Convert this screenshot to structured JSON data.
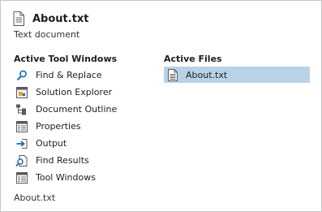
{
  "header": {
    "title": "About.txt",
    "subtitle": "Text document",
    "icon": "document-icon"
  },
  "tool_windows": {
    "heading": "Active Tool Windows",
    "items": [
      {
        "label": "Find & Replace",
        "icon": "find-replace-icon"
      },
      {
        "label": "Solution Explorer",
        "icon": "solution-explorer-icon"
      },
      {
        "label": "Document Outline",
        "icon": "document-outline-icon"
      },
      {
        "label": "Properties",
        "icon": "properties-icon"
      },
      {
        "label": "Output",
        "icon": "output-icon"
      },
      {
        "label": "Find Results",
        "icon": "find-results-icon"
      },
      {
        "label": "Tool Windows",
        "icon": "tool-windows-icon"
      }
    ]
  },
  "active_files": {
    "heading": "Active Files",
    "items": [
      {
        "label": "About.txt",
        "icon": "document-icon"
      }
    ]
  },
  "footer": {
    "path": "About.txt"
  },
  "colors": {
    "selection": "#b8d2e8",
    "accent_blue": "#1e6bb8",
    "border": "#c6c6c6"
  }
}
